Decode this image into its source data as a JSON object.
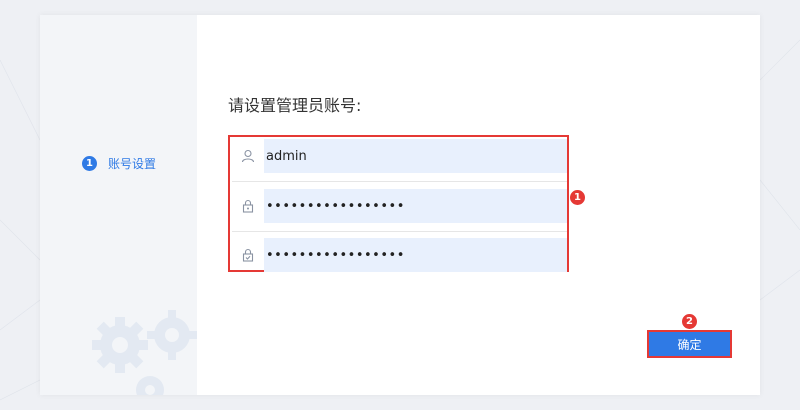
{
  "sidebar": {
    "step": {
      "number": "1",
      "label": "账号设置"
    }
  },
  "form": {
    "title": "请设置管理员账号:",
    "username": {
      "value": "admin",
      "icon": "user-icon"
    },
    "password": {
      "value": "•••••••••••••••••",
      "icon": "lock-icon"
    },
    "confirm_password": {
      "value": "•••••••••••••••••",
      "icon": "lock-check-icon"
    }
  },
  "annotations": {
    "form_marker": "1",
    "button_marker": "2"
  },
  "actions": {
    "confirm_label": "确定"
  },
  "colors": {
    "accent": "#2f7ae5",
    "highlight": "#e53935",
    "input_bg": "#e8f0fd"
  }
}
